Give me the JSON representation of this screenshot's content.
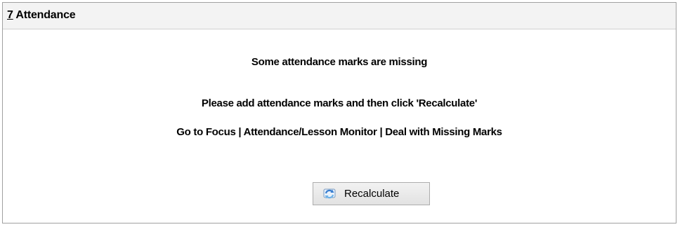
{
  "panel": {
    "title_mnemonic": "7",
    "title_rest": " Attendance"
  },
  "messages": {
    "line1": "Some attendance marks are missing",
    "line2": "Please add attendance marks and then click 'Recalculate'",
    "line3": "Go to Focus | Attendance/Lesson Monitor | Deal with Missing Marks"
  },
  "button": {
    "label": "Recalculate",
    "icon": "refresh-icon"
  },
  "colors": {
    "icon_primary": "#3a7fd0",
    "icon_secondary": "#6fb2e8"
  }
}
